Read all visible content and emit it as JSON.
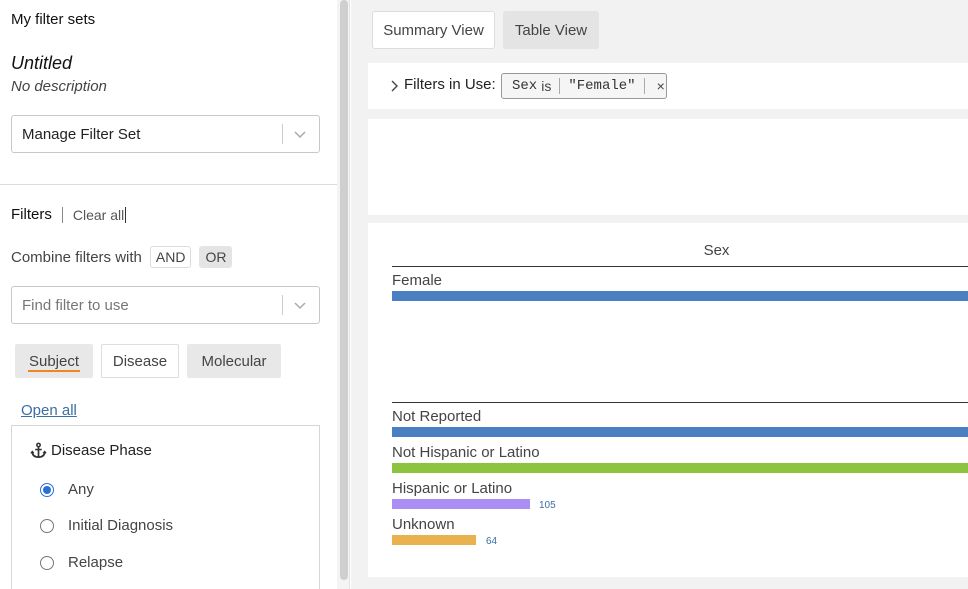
{
  "filter_sets": {
    "title": "My filter sets",
    "name": "Untitled",
    "description": "No description",
    "manage_select": "Manage Filter Set"
  },
  "filters": {
    "label": "Filters",
    "clear_all": "Clear all",
    "combine_label": "Combine filters with",
    "and_label": "AND",
    "or_label": "OR",
    "find_placeholder": "Find filter to use",
    "tabs": [
      "Subject",
      "Disease",
      "Molecular"
    ],
    "open_all": "Open all"
  },
  "disease_phase": {
    "title": "Disease Phase",
    "options": [
      "Any",
      "Initial Diagnosis",
      "Relapse"
    ],
    "selected": "Any"
  },
  "views": {
    "summary": "Summary View",
    "table": "Table View"
  },
  "filters_in_use": {
    "label": "Filters in Use:",
    "pill_field": "Sex",
    "pill_operator": "is",
    "pill_value": "\"Female\"",
    "pill_close": "×"
  },
  "charts": {
    "sex_title": "Sex",
    "sex_bars": [
      {
        "label": "Female",
        "color": "#4a7fc1"
      }
    ],
    "ethnicity_bars": [
      {
        "label": "Not Reported",
        "color": "#4a7fc1",
        "value_label": ""
      },
      {
        "label": "Not Hispanic or Latino",
        "color": "#8dc43f",
        "value_label": ""
      },
      {
        "label": "Hispanic or Latino",
        "color": "#a98ef3",
        "value_label": "105"
      },
      {
        "label": "Unknown",
        "color": "#e9b24e",
        "value_label": "64"
      }
    ]
  }
}
